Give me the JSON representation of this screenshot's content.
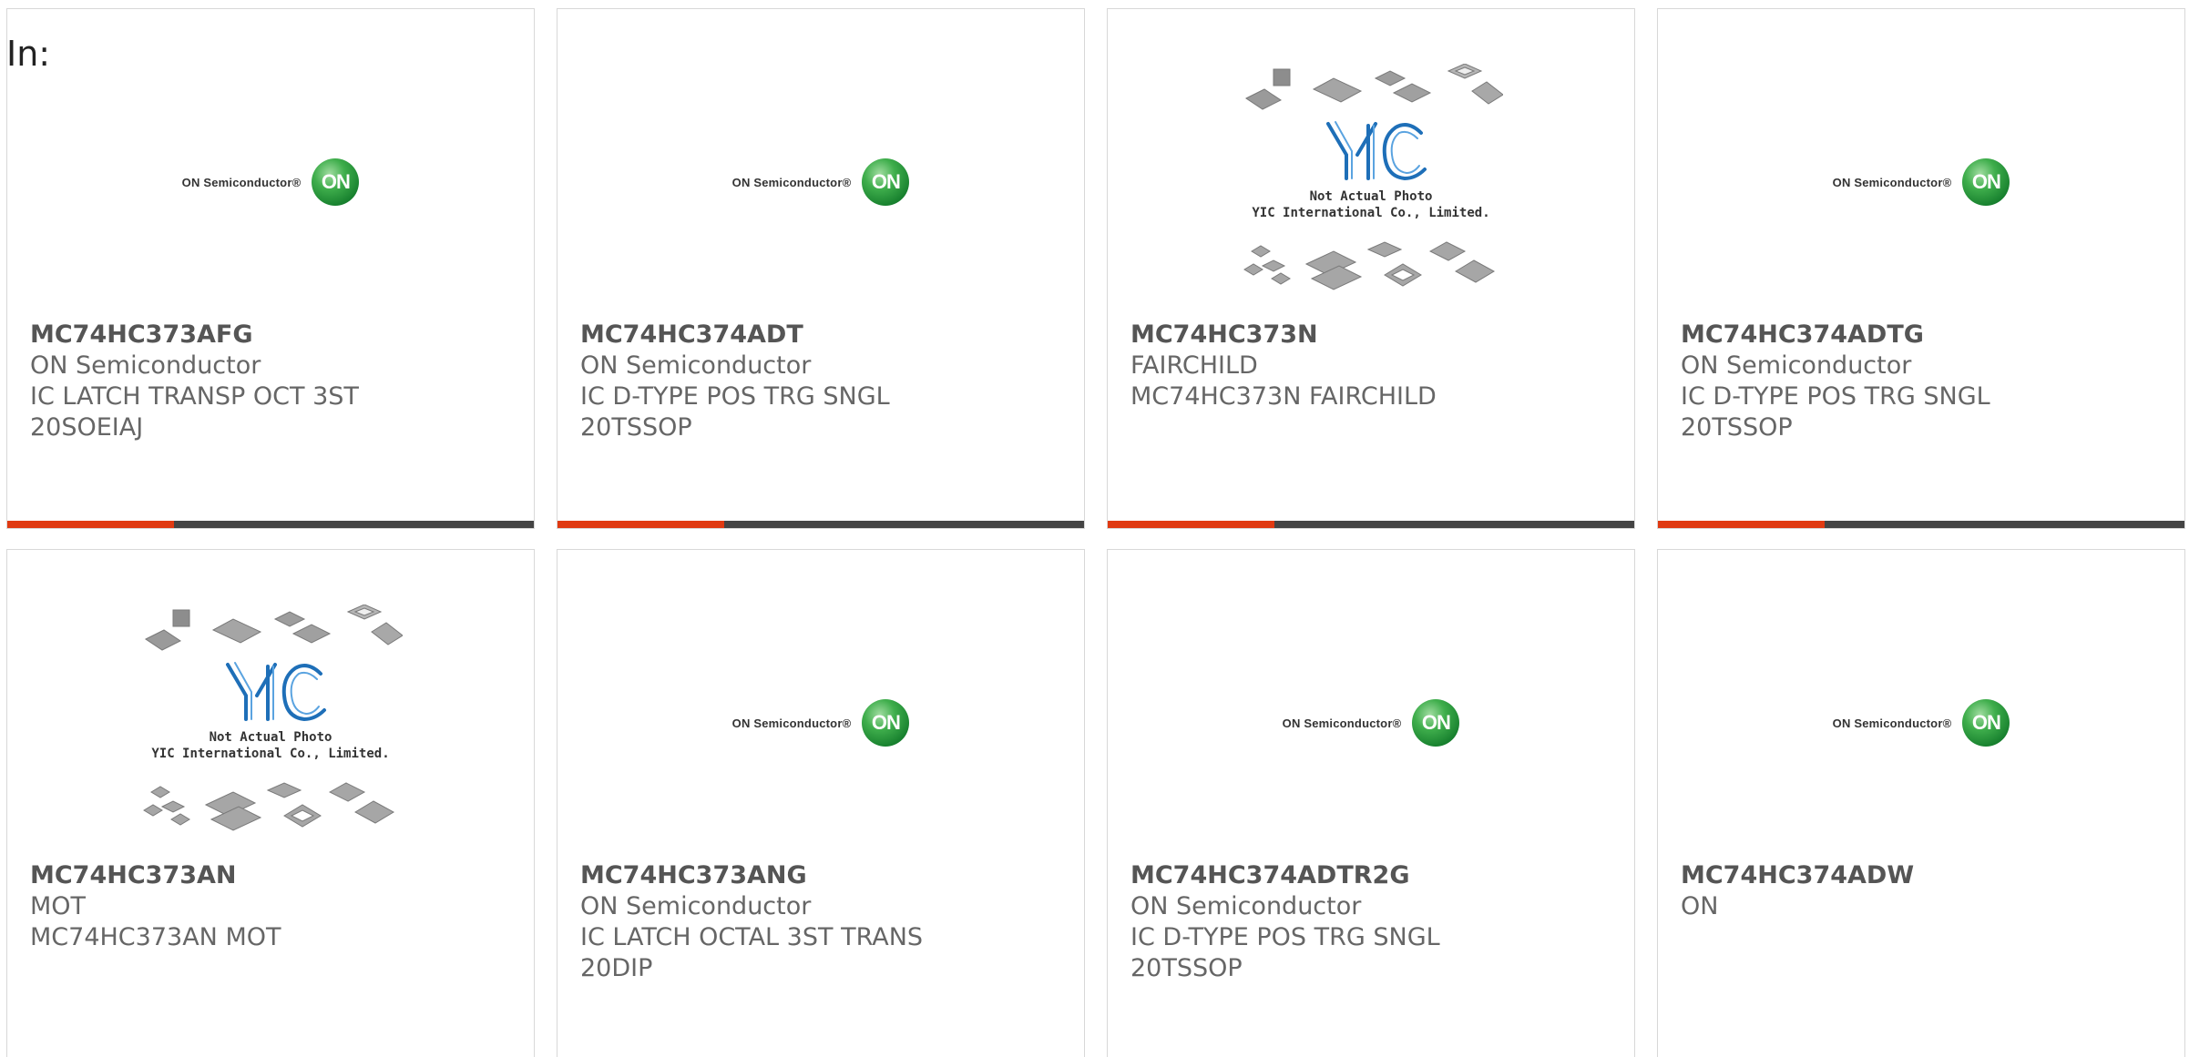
{
  "header": {
    "label": "In:"
  },
  "colors": {
    "accent": "#e03a12",
    "bar": "#444444",
    "on_green": "#1f8a35",
    "yic_blue": "#1e6fb8"
  },
  "logos": {
    "on": {
      "text": "ON Semiconductor",
      "mark": "ON",
      "reg": "®"
    },
    "yic": {
      "mark": "YIC",
      "line1": "Not Actual Photo",
      "line2": "YIC International Co., Limited."
    }
  },
  "products": [
    {
      "pn": "MC74HC373AFG",
      "mfr": "ON Semiconductor",
      "desc1": "IC LATCH TRANSP OCT 3ST",
      "desc2": "20SOEIAJ",
      "logo": "on"
    },
    {
      "pn": "MC74HC374ADT",
      "mfr": "ON Semiconductor",
      "desc1": "IC D-TYPE POS TRG SNGL",
      "desc2": "20TSSOP",
      "logo": "on"
    },
    {
      "pn": "MC74HC373N",
      "mfr": "FAIRCHILD",
      "desc1": "MC74HC373N FAIRCHILD",
      "desc2": "",
      "logo": "yic"
    },
    {
      "pn": "MC74HC374ADTG",
      "mfr": "ON Semiconductor",
      "desc1": "IC D-TYPE POS TRG SNGL",
      "desc2": "20TSSOP",
      "logo": "on"
    },
    {
      "pn": "MC74HC373AN",
      "mfr": "MOT",
      "desc1": "MC74HC373AN MOT",
      "desc2": "",
      "logo": "yic"
    },
    {
      "pn": "MC74HC373ANG",
      "mfr": "ON Semiconductor",
      "desc1": "IC LATCH OCTAL 3ST TRANS",
      "desc2": "20DIP",
      "logo": "on"
    },
    {
      "pn": "MC74HC374ADTR2G",
      "mfr": "ON Semiconductor",
      "desc1": "IC D-TYPE POS TRG SNGL",
      "desc2": "20TSSOP",
      "logo": "on"
    },
    {
      "pn": "MC74HC374ADW",
      "mfr": "ON",
      "desc1": "",
      "desc2": "",
      "logo": "on"
    }
  ]
}
